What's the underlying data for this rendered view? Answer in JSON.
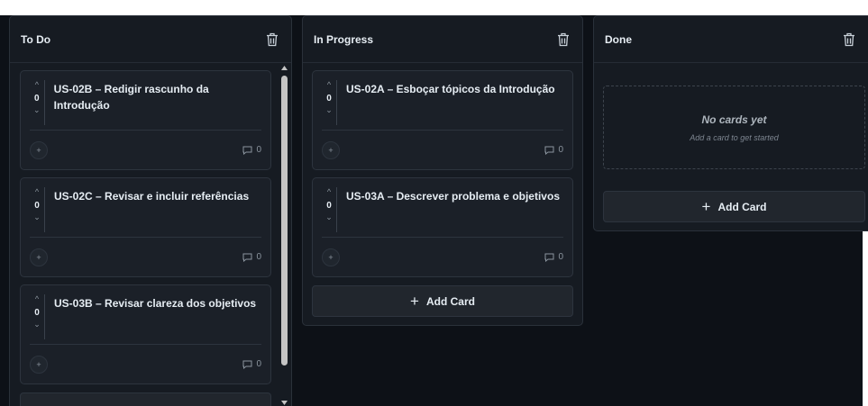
{
  "board": {
    "columns": [
      {
        "title": "To Do",
        "cards": [
          {
            "votes": "0",
            "title": "US-02B – Redigir rascunho da Introdução",
            "comments": "0"
          },
          {
            "votes": "0",
            "title": "US-02C – Revisar e incluir referências",
            "comments": "0"
          },
          {
            "votes": "0",
            "title": "US-03B – Revisar clareza dos objetivos",
            "comments": "0"
          }
        ]
      },
      {
        "title": "In Progress",
        "cards": [
          {
            "votes": "0",
            "title": "US-02A – Esboçar tópicos da Introdução",
            "comments": "0"
          },
          {
            "votes": "0",
            "title": "US-03A – Descrever problema e objetivos",
            "comments": "0"
          }
        ],
        "add_card_label": "Add Card"
      },
      {
        "title": "Done",
        "empty_title": "No cards yet",
        "empty_subtitle": "Add a card to get started",
        "add_card_label": "Add Card"
      }
    ]
  },
  "icons": {
    "delete": "trash-icon",
    "vote_up": "chevron-up-icon",
    "vote_down": "chevron-down-icon",
    "add_subtask": "plus-icon",
    "comments": "comment-icon",
    "add_card": "plus-icon"
  },
  "colors": {
    "background": "#0d1117",
    "column": "#161b22",
    "card": "#1b2028",
    "text": "#e6edf3",
    "muted": "#8b949e"
  }
}
